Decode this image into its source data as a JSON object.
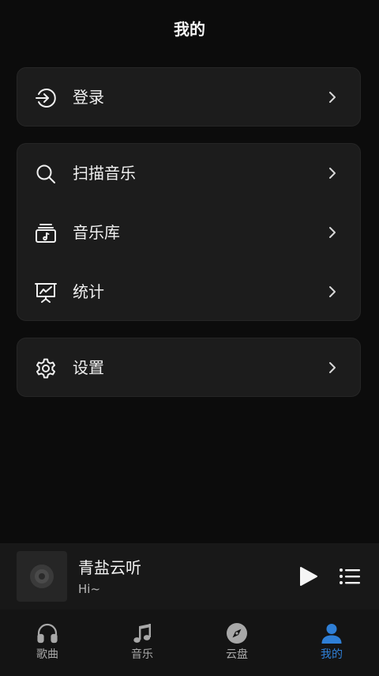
{
  "header": {
    "title": "我的"
  },
  "cards": [
    {
      "items": [
        {
          "label": "登录",
          "icon": "login-icon"
        }
      ]
    },
    {
      "items": [
        {
          "label": "扫描音乐",
          "icon": "search-icon"
        },
        {
          "label": "音乐库",
          "icon": "music-library-icon"
        },
        {
          "label": "统计",
          "icon": "statistics-icon"
        }
      ]
    },
    {
      "items": [
        {
          "label": "设置",
          "icon": "gear-icon"
        }
      ]
    }
  ],
  "player": {
    "title": "青盐云听",
    "subtitle": "Hi~",
    "cover_icon": "disc-icon",
    "play_icon": "play-icon",
    "playlist_icon": "playlist-icon"
  },
  "tabs": [
    {
      "label": "歌曲",
      "icon": "headphones-icon"
    },
    {
      "label": "音乐",
      "icon": "music-note-icon"
    },
    {
      "label": "云盘",
      "icon": "compass-icon"
    },
    {
      "label": "我的",
      "icon": "person-icon",
      "active": true
    }
  ],
  "colors": {
    "background": "#0c0c0c",
    "card": "#1c1c1c",
    "accent": "#2f7fd6",
    "text": "#f0f0f0",
    "muted": "#a8a8a8"
  }
}
